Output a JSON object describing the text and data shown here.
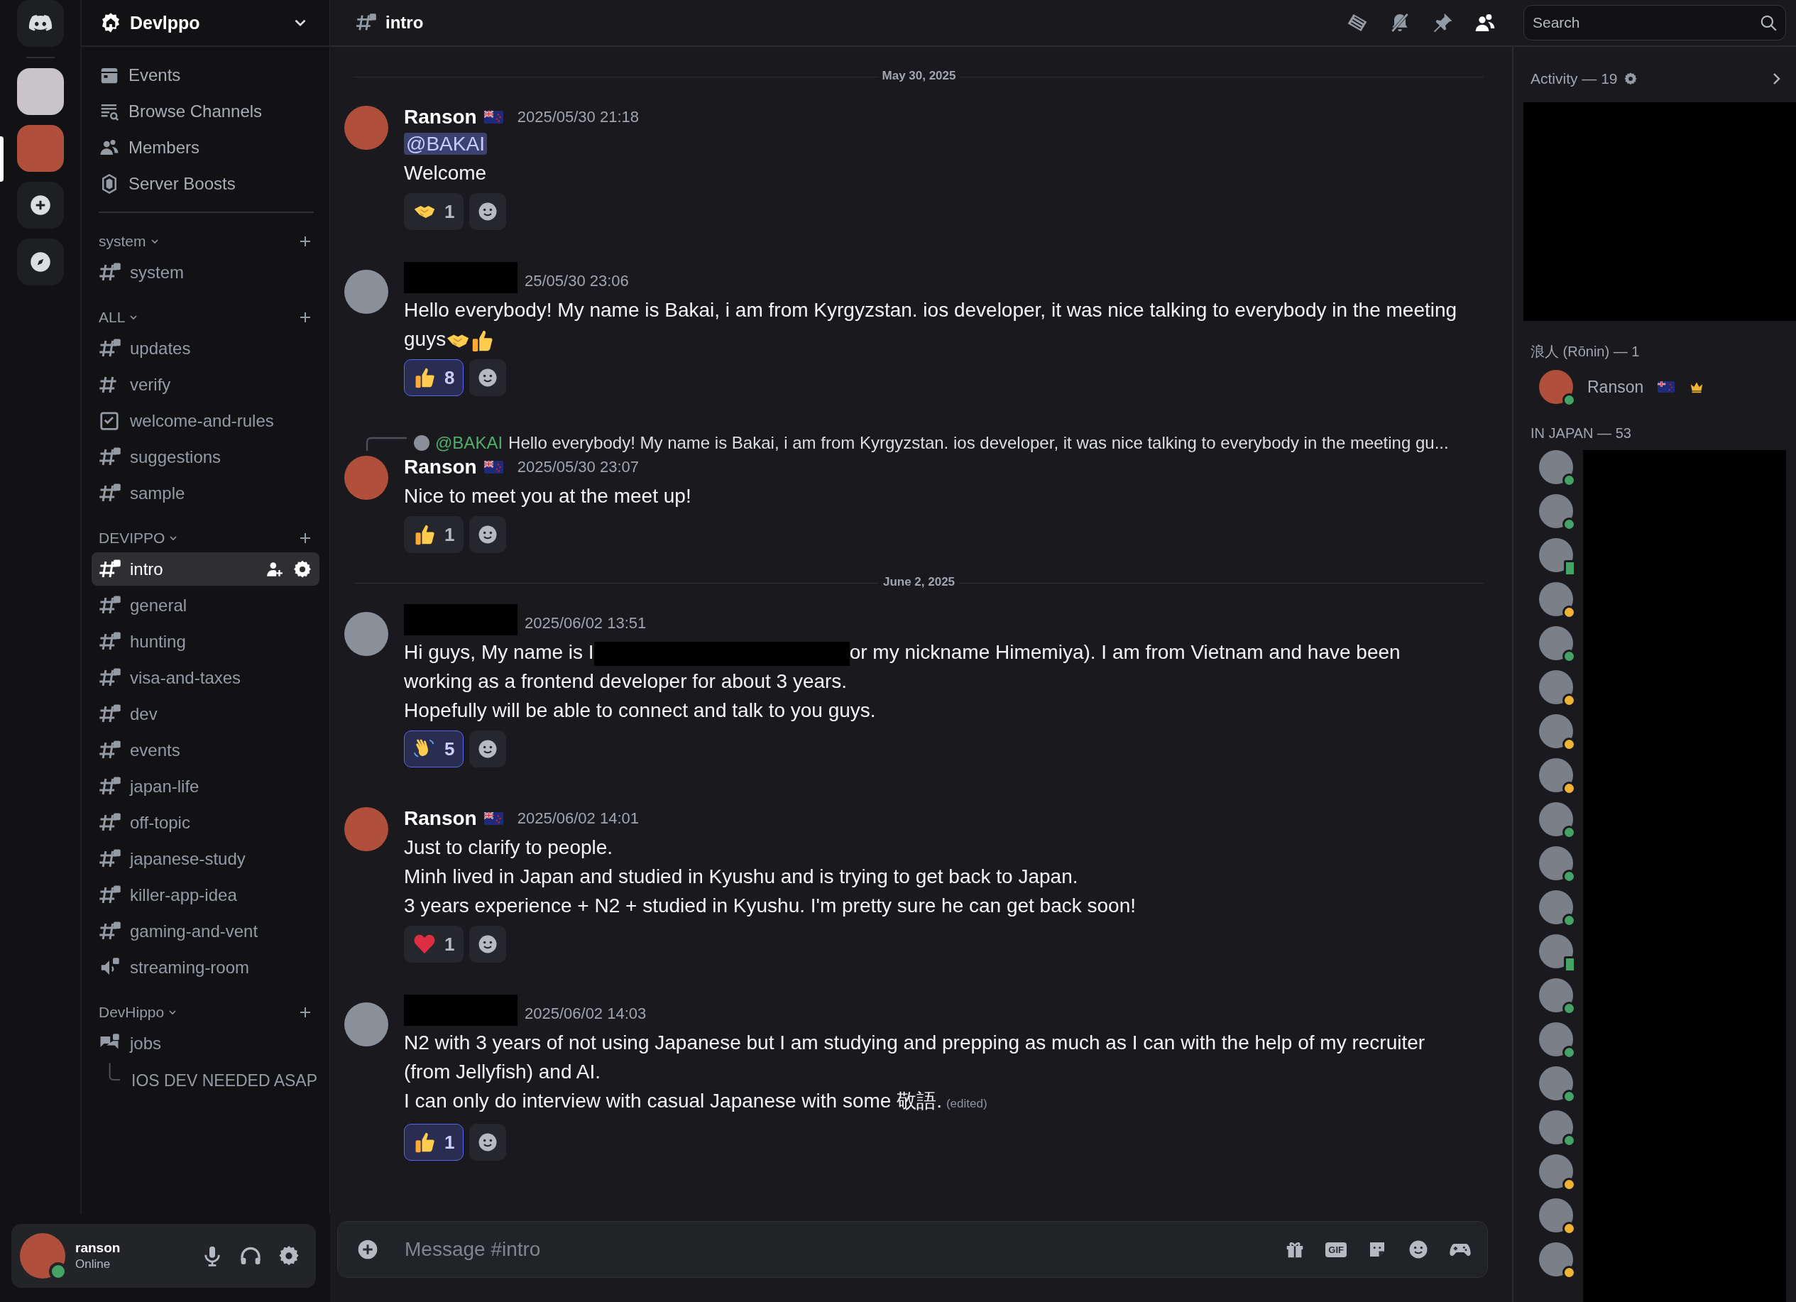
{
  "servers": [
    {
      "kind": "home",
      "selected": false
    },
    {
      "kind": "avatar",
      "selected": false
    },
    {
      "kind": "avatar",
      "selected": true
    },
    {
      "kind": "add",
      "selected": false
    },
    {
      "kind": "discover",
      "selected": false
    }
  ],
  "sidebar": {
    "server_name": "Devlppo",
    "nav": [
      {
        "kind": "events",
        "label": "Events"
      },
      {
        "kind": "browse",
        "label": "Browse Channels"
      },
      {
        "kind": "members",
        "label": "Members"
      },
      {
        "kind": "boosts",
        "label": "Server Boosts"
      }
    ],
    "categories": [
      {
        "name": "system",
        "channels": [
          {
            "name": "system",
            "kind": "text",
            "locked": true,
            "selected": false
          }
        ]
      },
      {
        "name": "ALL",
        "channels": [
          {
            "name": "updates",
            "kind": "text",
            "locked": true,
            "selected": false
          },
          {
            "name": "verify",
            "kind": "text",
            "locked": false,
            "selected": false
          },
          {
            "name": "welcome-and-rules",
            "kind": "rules",
            "locked": false,
            "selected": false
          },
          {
            "name": "suggestions",
            "kind": "text",
            "locked": true,
            "selected": false
          },
          {
            "name": "sample",
            "kind": "text",
            "locked": true,
            "selected": false
          }
        ]
      },
      {
        "name": "DEVIPPO",
        "channels": [
          {
            "name": "intro",
            "kind": "text",
            "locked": true,
            "selected": true
          },
          {
            "name": "general",
            "kind": "text",
            "locked": true,
            "selected": false
          },
          {
            "name": "hunting",
            "kind": "text",
            "locked": true,
            "selected": false
          },
          {
            "name": "visa-and-taxes",
            "kind": "text",
            "locked": true,
            "selected": false
          },
          {
            "name": "dev",
            "kind": "text",
            "locked": true,
            "selected": false
          },
          {
            "name": "events",
            "kind": "text",
            "locked": true,
            "selected": false
          },
          {
            "name": "japan-life",
            "kind": "text",
            "locked": true,
            "selected": false
          },
          {
            "name": "off-topic",
            "kind": "text",
            "locked": true,
            "selected": false
          },
          {
            "name": "japanese-study",
            "kind": "text",
            "locked": true,
            "selected": false
          },
          {
            "name": "killer-app-idea",
            "kind": "text",
            "locked": true,
            "selected": false
          },
          {
            "name": "gaming-and-vent",
            "kind": "text",
            "locked": true,
            "selected": false
          },
          {
            "name": "streaming-room",
            "kind": "voice",
            "locked": true,
            "selected": false
          }
        ]
      },
      {
        "name": "DevHippo",
        "channels": [
          {
            "name": "jobs",
            "kind": "forum",
            "locked": true,
            "selected": false,
            "children": [
              {
                "name": "IOS DEV NEEDED ASAP"
              }
            ]
          }
        ]
      }
    ]
  },
  "user_panel": {
    "name": "ranson",
    "status": "Online"
  },
  "header": {
    "channel": "intro",
    "search": {
      "placeholder": "Search"
    }
  },
  "feed": [
    {
      "kind": "divider",
      "label": "May 30, 2025"
    },
    {
      "kind": "message",
      "author": "Ranson",
      "flag": true,
      "time": "2025/05/30 21:18",
      "mention": "@BAKAI",
      "paragraphs": [
        {
          "segments": [
            "Welcome"
          ]
        }
      ],
      "reactions": [
        {
          "kind": "handshake",
          "count": "1",
          "selected": false
        }
      ]
    },
    {
      "kind": "message",
      "redacted": true,
      "time": "25/05/30 23:06",
      "paragraphs": [
        {
          "segments": [
            "Hello everybody! My name is Bakai, i am from Kyrgyzstan. ios developer, it was nice talking to everybody in the meeting"
          ]
        },
        {
          "segments": [
            "guys"
          ],
          "icons": [
            {
              "kind": "handshake"
            },
            {
              "kind": "thumbsup"
            }
          ]
        }
      ],
      "reactions": [
        {
          "kind": "thumbsup",
          "count": "8",
          "selected": true
        }
      ]
    },
    {
      "kind": "message",
      "author": "Ranson",
      "flag": true,
      "time": "2025/05/30 23:07",
      "reply": {
        "mention": "@BAKAI",
        "text": "Hello everybody! My name is Bakai, i am from Kyrgyzstan. ios developer, it was nice talking to everybody in the meeting gu..."
      },
      "paragraphs": [
        {
          "segments": [
            "Nice to meet you at the meet up!"
          ]
        }
      ],
      "reactions": [
        {
          "kind": "thumbsup",
          "count": "1",
          "selected": false
        }
      ]
    },
    {
      "kind": "divider",
      "label": "June 2, 2025"
    },
    {
      "kind": "message",
      "redacted": true,
      "time": "2025/06/02 13:51",
      "paragraphs": [
        {
          "segments": [
            "Hi guys, My name is I",
            "or my nickname Himemiya). I am from Vietnam and have been"
          ]
        },
        {
          "segments": [
            "working as a frontend developer for about 3 years."
          ]
        },
        {
          "segments": [
            "Hopefully will be able to connect and talk to you guys."
          ]
        }
      ],
      "reactions": [
        {
          "kind": "wave",
          "count": "5",
          "selected": true
        }
      ]
    },
    {
      "kind": "message",
      "author": "Ranson",
      "flag": true,
      "time": "2025/06/02 14:01",
      "paragraphs": [
        {
          "segments": [
            "Just to clarify to people."
          ]
        },
        {
          "segments": [
            "Minh lived in Japan and studied in Kyushu and is trying to get back to Japan."
          ]
        },
        {
          "segments": [
            "3 years experience + N2 + studied in Kyushu. I'm pretty sure he can get back soon!"
          ]
        }
      ],
      "reactions": [
        {
          "kind": "heart",
          "count": "1",
          "selected": false
        }
      ]
    },
    {
      "kind": "message",
      "redacted": true,
      "time": "2025/06/02 14:03",
      "paragraphs": [
        {
          "segments": [
            "N2 with 3 years of not using Japanese but I am studying and prepping as much as I can with the help of my recruiter"
          ]
        },
        {
          "segments": [
            "(from Jellyfish) and AI."
          ]
        },
        {
          "segments": [
            "I can only do interview with casual Japanese with some 敬語."
          ],
          "edited": "(edited)"
        }
      ],
      "reactions": [
        {
          "kind": "thumbsup",
          "count": "1",
          "selected": true
        }
      ]
    }
  ],
  "composer": {
    "placeholder": "Message #intro",
    "gif_label": "GIF"
  },
  "members": {
    "activity": "Activity — 19",
    "groups": [
      {
        "title": "浪人 (Rōnin) — 1",
        "members": [
          {
            "name": "Ranson",
            "flag": true,
            "owner": true,
            "kind": "online"
          }
        ]
      },
      {
        "title": "IN JAPAN — 53",
        "redacted": true,
        "members": [
          {
            "kind": "online"
          },
          {
            "kind": "online"
          },
          {
            "kind": "mobile"
          },
          {
            "kind": "idle"
          },
          {
            "kind": "online"
          },
          {
            "kind": "idle"
          },
          {
            "kind": "idle"
          },
          {
            "kind": "idle"
          },
          {
            "kind": "online"
          },
          {
            "kind": "online"
          },
          {
            "kind": "online"
          },
          {
            "kind": "mobile"
          },
          {
            "kind": "online"
          },
          {
            "kind": "online"
          },
          {
            "kind": "online"
          },
          {
            "kind": "online"
          },
          {
            "kind": "idle"
          },
          {
            "kind": "idle"
          },
          {
            "kind": "idle"
          }
        ]
      }
    ]
  }
}
